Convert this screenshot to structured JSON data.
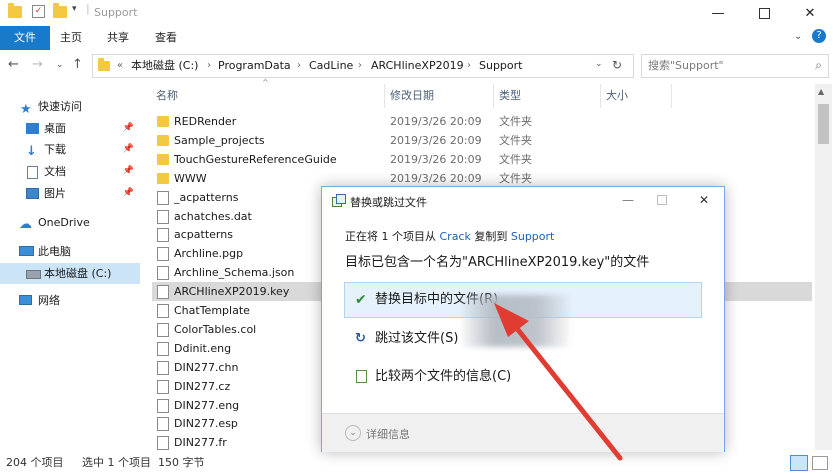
{
  "window": {
    "title": "Support"
  },
  "ribbon": {
    "tabs": [
      "文件",
      "主页",
      "共享",
      "查看"
    ]
  },
  "address": {
    "crumbs": [
      "本地磁盘 (C:)",
      "ProgramData",
      "CadLine",
      "ARCHlineXP2019",
      "Support"
    ],
    "overflow": "«",
    "search_placeholder": "搜索\"Support\""
  },
  "nav": {
    "items": [
      {
        "label": "快速访问",
        "icon": "star-icon"
      },
      {
        "label": "桌面",
        "icon": "desktop-icon"
      },
      {
        "label": "下载",
        "icon": "download-icon"
      },
      {
        "label": "文档",
        "icon": "document-icon"
      },
      {
        "label": "图片",
        "icon": "pictures-icon"
      },
      {
        "label": "OneDrive",
        "icon": "cloud-icon"
      },
      {
        "label": "此电脑",
        "icon": "computer-icon"
      },
      {
        "label": "本地磁盘 (C:)",
        "icon": "drive-icon"
      },
      {
        "label": "网络",
        "icon": "network-icon"
      }
    ]
  },
  "columns": {
    "name": "名称",
    "date": "修改日期",
    "type": "类型",
    "size": "大小"
  },
  "files": [
    {
      "name": "REDRender",
      "date": "2019/3/26 20:09",
      "type": "文件夹",
      "kind": "folder"
    },
    {
      "name": "Sample_projects",
      "date": "2019/3/26 20:09",
      "type": "文件夹",
      "kind": "folder"
    },
    {
      "name": "TouchGestureReferenceGuide",
      "date": "2019/3/26 20:09",
      "type": "文件夹",
      "kind": "folder"
    },
    {
      "name": "WWW",
      "date": "2019/3/26 20:09",
      "type": "文件夹",
      "kind": "folder"
    },
    {
      "name": "_acpatterns",
      "date": "",
      "type": "",
      "kind": "file"
    },
    {
      "name": "achatches.dat",
      "date": "",
      "type": "",
      "kind": "file"
    },
    {
      "name": "acpatterns",
      "date": "",
      "type": "",
      "kind": "file"
    },
    {
      "name": "Archline.pgp",
      "date": "",
      "type": "",
      "kind": "file"
    },
    {
      "name": "Archline_Schema.json",
      "date": "",
      "type": "",
      "kind": "file"
    },
    {
      "name": "ARCHlineXP2019.key",
      "date": "",
      "type": "",
      "kind": "file"
    },
    {
      "name": "ChatTemplate",
      "date": "",
      "type": "",
      "kind": "file"
    },
    {
      "name": "ColorTables.col",
      "date": "",
      "type": "",
      "kind": "file"
    },
    {
      "name": "Ddinit.eng",
      "date": "",
      "type": "",
      "kind": "file"
    },
    {
      "name": "DIN277.chn",
      "date": "",
      "type": "",
      "kind": "file"
    },
    {
      "name": "DIN277.cz",
      "date": "",
      "type": "",
      "kind": "file"
    },
    {
      "name": "DIN277.eng",
      "date": "",
      "type": "",
      "kind": "file"
    },
    {
      "name": "DIN277.esp",
      "date": "",
      "type": "",
      "kind": "file"
    },
    {
      "name": "DIN277.fr",
      "date": "",
      "type": "",
      "kind": "file"
    }
  ],
  "status": {
    "count": "204 个项目",
    "selected": "选中 1 个项目  150 字节"
  },
  "dialog": {
    "title": "替换或跳过文件",
    "line1_prefix": "正在将 1 个项目从",
    "line1_src": "Crack",
    "line1_mid": "复制到",
    "line1_dst": "Support",
    "heading": "目标已包含一个名为\"ARCHlineXP2019.key\"的文件",
    "opt_replace": "替换目标中的文件(R)",
    "opt_skip": "跳过该文件(S)",
    "opt_compare": "比较两个文件的信息(C)",
    "details": "详细信息"
  },
  "colors": {
    "accent": "#1979ca",
    "arrow": "#e03c31",
    "selection": "#cce4f7"
  }
}
